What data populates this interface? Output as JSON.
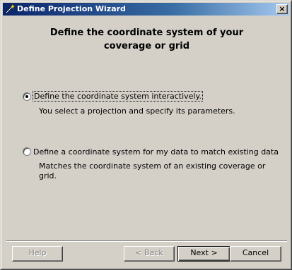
{
  "window": {
    "title": "Define Projection Wizard",
    "close_glyph": "×"
  },
  "heading": {
    "line1": "Define the coordinate system of your",
    "line2": "coverage or grid"
  },
  "options": [
    {
      "label": "Define the coordinate system interactively.",
      "description": [
        "You select a projection and specify its parameters."
      ],
      "selected": true
    },
    {
      "label": "Define a coordinate system for my data to match existing data",
      "description": [
        "Matches the coordinate system of an existing coverage or",
        "grid."
      ],
      "selected": false
    }
  ],
  "buttons": {
    "help": "Help",
    "back": "< Back",
    "next": "Next >",
    "cancel": "Cancel"
  },
  "icons": {
    "title_icon": "wand-icon",
    "close_icon": "close-icon"
  },
  "colors": {
    "titlebar_start": "#0a246a",
    "titlebar_end": "#a6caf0",
    "face": "#d4d0c8"
  }
}
